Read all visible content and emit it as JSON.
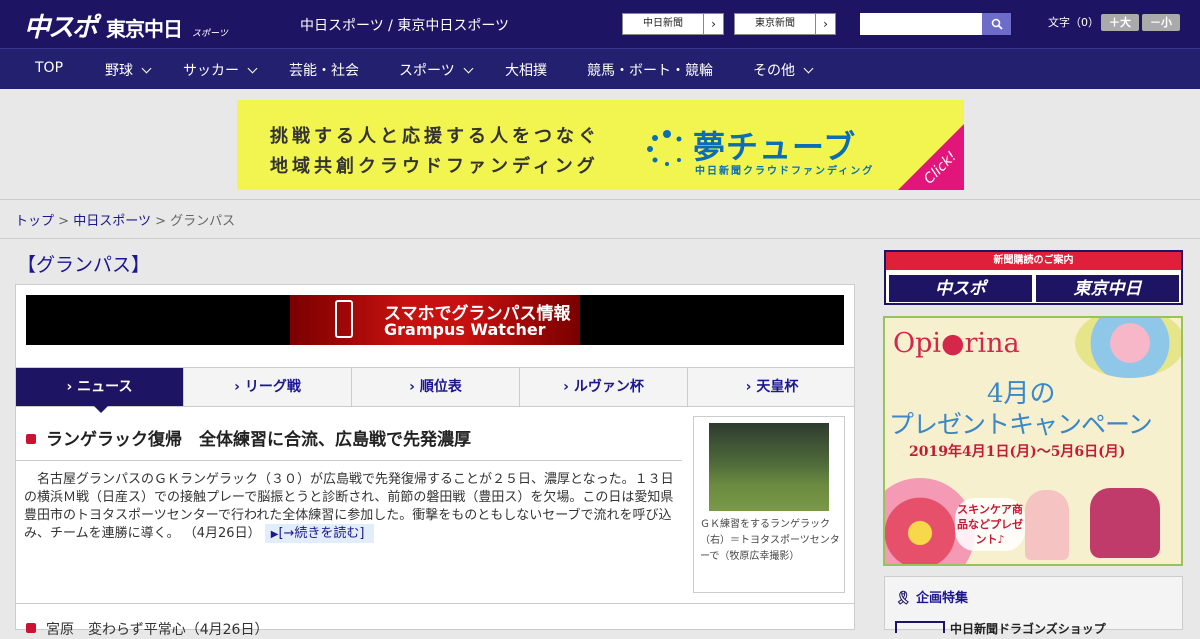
{
  "header": {
    "logo_a": "中スポ",
    "logo_b": "東京中日",
    "logo_c": "スポーツ",
    "site_title": "中日スポーツ / 東京中日スポーツ",
    "paper_links": [
      {
        "label": "中日新聞"
      },
      {
        "label": "東京新聞"
      }
    ],
    "search_placeholder": "",
    "font_size_label": "文字（0）",
    "font_larger": "＋大",
    "font_smaller": "－小"
  },
  "nav": [
    {
      "label": "TOP",
      "has_dropdown": false
    },
    {
      "label": "野球",
      "has_dropdown": true
    },
    {
      "label": "サッカー",
      "has_dropdown": true
    },
    {
      "label": "芸能・社会",
      "has_dropdown": false
    },
    {
      "label": "スポーツ",
      "has_dropdown": true
    },
    {
      "label": "大相撲",
      "has_dropdown": false
    },
    {
      "label": "競馬・ボート・競輪",
      "has_dropdown": false
    },
    {
      "label": "その他",
      "has_dropdown": true
    }
  ],
  "ad_banner": {
    "line1": "挑戦する人と応援する人をつなぐ",
    "line2": "地域共創クラウドファンディング",
    "brand": "夢チューブ",
    "brand_sub": "中日新聞クラウドファンディング",
    "click": "Click!"
  },
  "breadcrumb": {
    "items": [
      "トップ",
      "中日スポーツ"
    ],
    "current": "グランパス",
    "separator": ">"
  },
  "page_title": "【グランパス】",
  "grampus_banner": {
    "line1": "スマホでグランパス情報",
    "line2": "Grampus Watcher"
  },
  "tabs": [
    {
      "label": "ニュース",
      "active": true
    },
    {
      "label": "リーグ戦",
      "active": false
    },
    {
      "label": "順位表",
      "active": false
    },
    {
      "label": "ルヴァン杯",
      "active": false
    },
    {
      "label": "天皇杯",
      "active": false
    }
  ],
  "article": {
    "headline": "ランゲラック復帰　全体練習に合流、広島戦で先発濃厚",
    "body": "名古屋グランパスのＧＫランゲラック（３０）が広島戦で先発復帰することが２５日、濃厚となった。１３日の横浜Ｍ戦（日産ス）での接触プレーで脳振とうと診断され、前節の磐田戦（豊田ス）を欠場。この日は愛知県豊田市のトヨタスポーツセンターで行われた全体練習に参加した。衝撃をものともしないセーブで流れを呼び込み、チームを連勝に導く。",
    "date": "（4月26日）",
    "more": "[→続きを読む]",
    "photo_caption": "ＧＫ練習をするランゲラック（右）＝トヨタスポーツセンターで（牧原広幸撮影）"
  },
  "next_item": "宮原　変わらず平常心（4月26日）",
  "sidebar": {
    "subscribe_header": "新聞購読のご案内",
    "subscribe_buttons": [
      "中スポ",
      "東京中日"
    ],
    "promo": {
      "brand": "Opi●rina",
      "month": "4月の",
      "campaign": "プレゼントキャンペーン",
      "dates": "2019年4月1日(月)～5月6日(月)",
      "note": "スキンケア商品などプレゼント♪"
    },
    "feature_title": "企画特集",
    "feature_item": "中日新聞ドラゴンズショップ"
  },
  "colors": {
    "header_bg": "#1e1464",
    "accent_red": "#cc1133",
    "link": "#1c1690"
  }
}
